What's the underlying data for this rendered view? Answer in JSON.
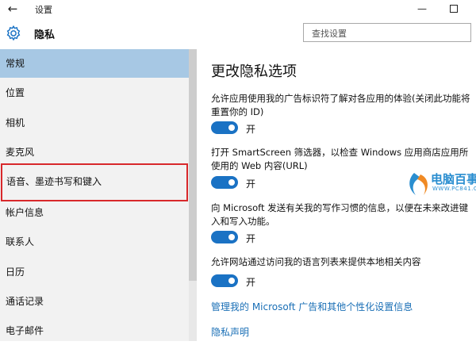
{
  "window": {
    "back_glyph": "←",
    "app_title": "设置",
    "minimize_glyph": "—"
  },
  "header": {
    "icon": "gear-icon",
    "title": "隐私"
  },
  "search": {
    "placeholder": "查找设置",
    "value": ""
  },
  "sidebar": {
    "items": [
      {
        "label": "常规"
      },
      {
        "label": "位置"
      },
      {
        "label": "相机"
      },
      {
        "label": "麦克风"
      },
      {
        "label": "语音、墨迹书写和键入"
      },
      {
        "label": "帐户信息"
      },
      {
        "label": "联系人"
      },
      {
        "label": "日历"
      },
      {
        "label": "通话记录"
      },
      {
        "label": "电子邮件"
      }
    ],
    "active_index": 0,
    "highlighted_index": 4
  },
  "main": {
    "title": "更改隐私选项",
    "options": [
      {
        "text": "允许应用使用我的广告标识符了解对各应用的体验(关闭此功能将重置你的 ID)",
        "state": "开",
        "on": true
      },
      {
        "text": "打开 SmartScreen 筛选器，以检查 Windows 应用商店应用所使用的 Web 内容(URL)",
        "state": "开",
        "on": true
      },
      {
        "text": "向 Microsoft 发送有关我的写作习惯的信息，以便在未来改进键入和写入功能。",
        "state": "开",
        "on": true
      },
      {
        "text": "允许网站通过访问我的语言列表来提供本地相关内容",
        "state": "开",
        "on": true
      }
    ],
    "links": [
      {
        "label": "管理我的 Microsoft 广告和其他个性化设置信息"
      },
      {
        "label": "隐私声明"
      }
    ]
  },
  "watermark": {
    "text": "电脑百事网",
    "url": "WWW.PC841.COM"
  },
  "colors": {
    "accent": "#1a72c4",
    "link": "#1a6fb6",
    "active_item": "#a7c8e4",
    "highlight_box": "#d8282b",
    "sidebar_bg": "#f2f2f2"
  }
}
